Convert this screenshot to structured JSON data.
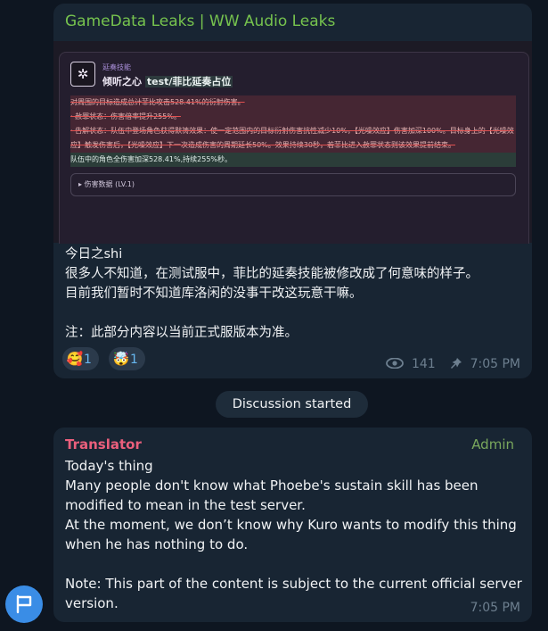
{
  "post": {
    "title": "GameData Leaks | WW Audio Leaks",
    "embed": {
      "skill_tag": "延奏技能",
      "skill_name": "倾听之心",
      "test_label": "test/菲比延奏占位",
      "lines": [
        "对周围的目标造成总计菲比攻击528.41%的衍射伤害。",
        "· 赦罪状态：伤害倍率提升255%。",
        "· 告解状态：队伍中登场角色获得默祷效果：使一定范围内的目标衍射伤害抗性减少10%，【光噪效应】伤害加深100%。目标身上的【光噪效应】触发伤害后，【光噪效应】下一次造成伤害的周期延长50%。效果持续30秒，若菲比进入赦罪状态则该效果提前结束。",
        "队伍中的角色全伤害加深528.41%,持续255%秒。"
      ],
      "damage_box_label": "▸ 伤害数据 (LV.1)"
    },
    "body": "今日之shi\n很多人不知道，在测试服中，菲比的延奏技能被修改成了何意味的样子。\n目前我们暂时不知道库洛闲的没事干改这玩意干嘛。\n\n注：此部分内容以当前正式服版本为准。",
    "reactions": [
      {
        "emoji": "🥰",
        "count": "1"
      },
      {
        "emoji": "🤯",
        "count": "1"
      }
    ],
    "views": "141",
    "time": "7:05 PM"
  },
  "service_message": "Discussion started",
  "reply": {
    "author": "Translator",
    "badge": "Admin",
    "body": "Today's thing\nMany people don't know what Phoebe's sustain skill has been modified to mean in the test server.\nAt the moment, we don’t know why Kuro wants to modify this thing when he has nothing to do.\n\nNote: This part of the content is subject to the current official server version.",
    "time": "7:05 PM"
  },
  "colors": {
    "background": "#0e1621",
    "bubble": "#182533",
    "title_green": "#76c34e",
    "author_pink": "#ea5f7c",
    "admin_green": "#7aa85d",
    "meta_gray": "#6d7f8f",
    "avatar_blue": "#3a8de6"
  },
  "icons": {
    "views": "eye-icon",
    "pinned": "pin-icon",
    "avatar": "flag-icon",
    "skill": "skill-emblem-icon"
  }
}
